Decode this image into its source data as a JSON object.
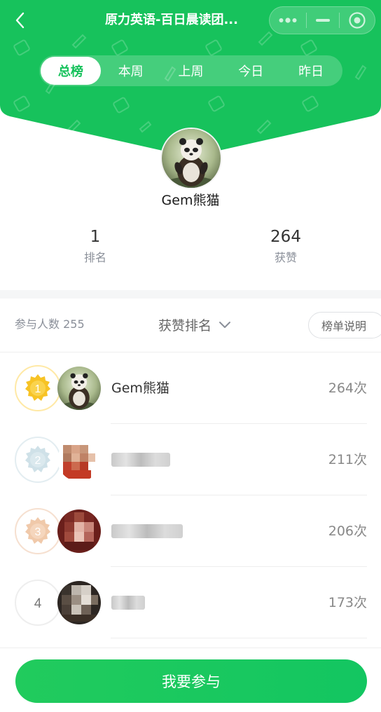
{
  "header": {
    "title": "原力英语-百日晨读团...",
    "back_icon": "chevron-left-icon",
    "menu_icons": [
      "more-dots-icon",
      "minimize-icon",
      "close-target-icon"
    ],
    "accent_color": "#17c25c"
  },
  "tabs": [
    {
      "label": "总榜",
      "active": true
    },
    {
      "label": "本周",
      "active": false
    },
    {
      "label": "上周",
      "active": false
    },
    {
      "label": "今日",
      "active": false
    },
    {
      "label": "昨日",
      "active": false
    }
  ],
  "profile": {
    "name": "Gem熊猫",
    "rank_value": "1",
    "rank_label": "排名",
    "likes_value": "264",
    "likes_label": "获赞"
  },
  "toolbar": {
    "participants": "参与人数 255",
    "sort_label": "获赞排名",
    "explain_label": "榜单说明"
  },
  "leaderboard": [
    {
      "rank": "1",
      "name": "Gem熊猫",
      "likes": "264次",
      "name_blurred": false,
      "medal": "gold"
    },
    {
      "rank": "2",
      "name": "",
      "likes": "211次",
      "name_blurred": true,
      "medal": "silver"
    },
    {
      "rank": "3",
      "name": "",
      "likes": "206次",
      "name_blurred": true,
      "medal": "bronze"
    },
    {
      "rank": "4",
      "name": "",
      "likes": "173次",
      "name_blurred": true,
      "medal": "plain"
    }
  ],
  "join_button": "我要参与"
}
